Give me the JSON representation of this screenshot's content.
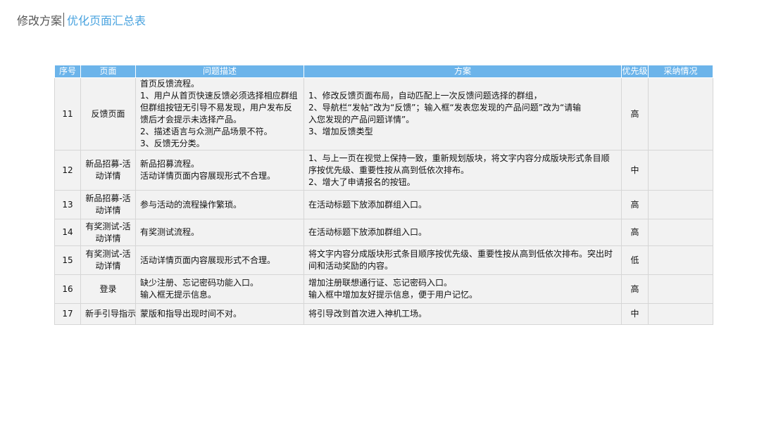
{
  "header": {
    "title": "修改方案",
    "subtitle": "优化页面汇总表"
  },
  "table": {
    "columns": [
      "序号",
      "页面",
      "问题描述",
      "方案",
      "优先级",
      "采纳情况"
    ],
    "rows": [
      {
        "no": "11",
        "page": [
          "反馈页面"
        ],
        "desc": [
          "首页反馈流程。",
          "1、用户从首页快速反馈必须选择相应群组",
          "但群组按钮无引导不易发现，用户发布反",
          "馈后才会提示未选择产品。",
          "2、描述语言与众测产品场景不符。",
          "3、反馈无分类。"
        ],
        "solution": [
          "1、修改反馈页面布局，自动匹配上一次反馈问题选择的群组，",
          "2、导航栏“发帖”改为“反馈”；输入框“发表您发现的产品问题”改为“请输",
          "入您发现的产品问题详情”。",
          "3、增加反馈类型"
        ],
        "priority": "高",
        "adopt": ""
      },
      {
        "no": "12",
        "page": [
          "新品招募-活",
          "动详情"
        ],
        "desc": [
          "新品招募流程。",
          "活动详情页面内容展现形式不合理。"
        ],
        "solution": [
          "1、与上一页在视觉上保持一致，重新规划版块，将文字内容分成版块形式条目顺",
          "序按优先级、重要性按从高到低依次排布。",
          "2、增大了申请报名的按钮。"
        ],
        "priority": "中",
        "adopt": ""
      },
      {
        "no": "13",
        "page": [
          "新品招募-活",
          "动详情"
        ],
        "desc": [
          "参与活动的流程操作繁琐。"
        ],
        "solution": [
          "在活动标题下放添加群组入口。"
        ],
        "priority": "高",
        "adopt": ""
      },
      {
        "no": "14",
        "page": [
          "有奖测试-活",
          "动详情"
        ],
        "desc": [
          "有奖测试流程。"
        ],
        "solution": [
          "在活动标题下放添加群组入口。"
        ],
        "priority": "高",
        "adopt": ""
      },
      {
        "no": "15",
        "page": [
          "有奖测试-活",
          "动详情"
        ],
        "desc": [
          "活动详情页面内容展现形式不合理。"
        ],
        "solution": [
          "将文字内容分成版块形式条目顺序按优先级、重要性按从高到低依次排布。突出时",
          "间和活动奖励的内容。"
        ],
        "priority": "低",
        "adopt": ""
      },
      {
        "no": "16",
        "page": [
          "登录"
        ],
        "desc": [
          "缺少注册、忘记密码功能入口。",
          "输入框无提示信息。"
        ],
        "solution": [
          "增加注册联想通行证、忘记密码入口。",
          "输入框中增加友好提示信息，便于用户记忆。"
        ],
        "priority": "高",
        "adopt": ""
      },
      {
        "no": "17",
        "page": [
          "新手引导指示"
        ],
        "desc": [
          "蒙版和指导出现时间不对。"
        ],
        "solution": [
          "将引导改到首次进入神机工场。"
        ],
        "priority": "中",
        "adopt": ""
      }
    ]
  }
}
